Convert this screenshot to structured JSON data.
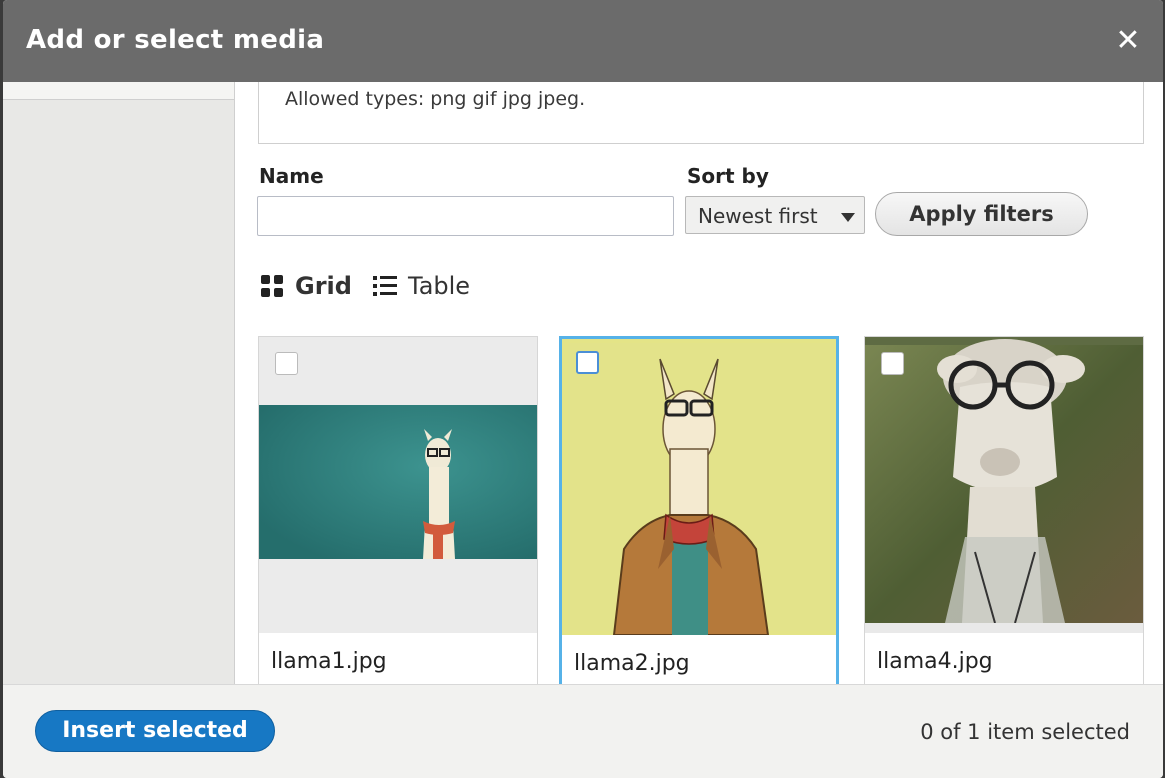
{
  "dialog": {
    "title": "Add or select media",
    "close_label": "✕"
  },
  "upload": {
    "allowed_types": "Allowed types: png gif jpg jpeg."
  },
  "filters": {
    "name_label": "Name",
    "name_value": "",
    "sort_label": "Sort by",
    "sort_value": "Newest first",
    "apply_label": "Apply filters"
  },
  "views": {
    "grid_label": "Grid",
    "table_label": "Table"
  },
  "media_items": [
    {
      "name": "llama1.jpg",
      "selected": false
    },
    {
      "name": "llama2.jpg",
      "selected": true
    },
    {
      "name": "llama4.jpg",
      "selected": false
    }
  ],
  "footer": {
    "insert_label": "Insert selected",
    "selection_count": "0 of 1 item selected"
  },
  "colors": {
    "titlebar": "#6b6b6b",
    "primary_button": "#1778c4",
    "selected_border": "#56b2e8"
  }
}
